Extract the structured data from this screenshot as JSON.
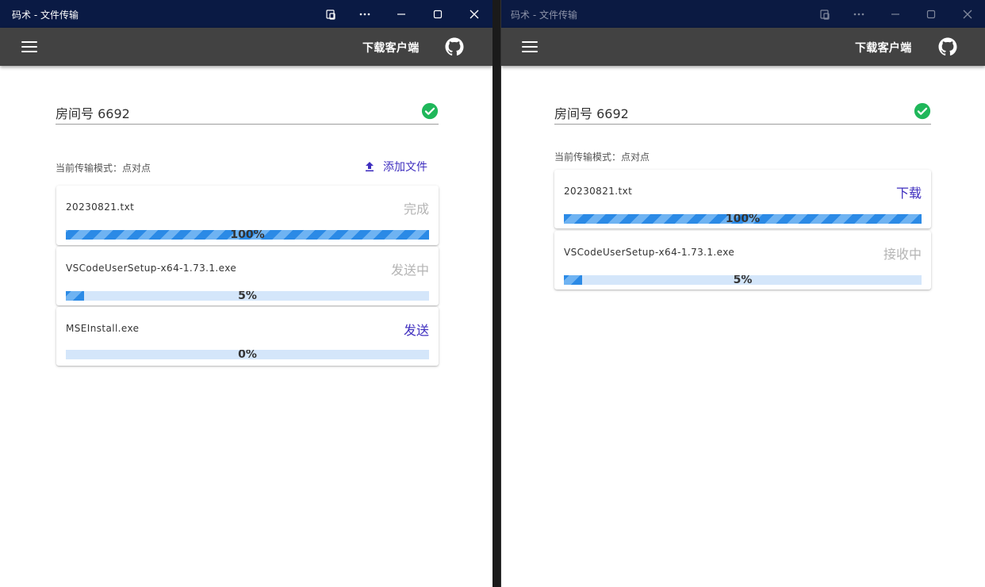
{
  "left_window": {
    "title": "码术 - 文件传输",
    "download_label": "下载客户端",
    "room_label": "房间号 6692",
    "mode_label": "当前传输模式：点对点",
    "add_file_label": "添加文件",
    "files": [
      {
        "name": "20230821.txt",
        "status": "完成",
        "progress": 100,
        "progress_label": "100%"
      },
      {
        "name": "VSCodeUserSetup-x64-1.73.1.exe",
        "status": "发送中",
        "progress": 5,
        "progress_label": "5%"
      },
      {
        "name": "MSEInstall.exe",
        "status": "发送",
        "progress": 0,
        "progress_label": "0%"
      }
    ]
  },
  "right_window": {
    "title": "码术 - 文件传输",
    "download_label": "下载客户端",
    "room_label": "房间号 6692",
    "mode_label": "当前传输模式：点对点",
    "files": [
      {
        "name": "20230821.txt",
        "status": "下载",
        "progress": 100,
        "progress_label": "100%"
      },
      {
        "name": "VSCodeUserSetup-x64-1.73.1.exe",
        "status": "接收中",
        "progress": 5,
        "progress_label": "5%"
      }
    ]
  },
  "colors": {
    "accent": "#3f2fbf",
    "appbar": "#424242",
    "titlebar": "#0a1a44",
    "success": "#1fb75a",
    "progress_fill": "#2b8ae6",
    "progress_track": "#d4e6fa"
  },
  "icons": {
    "menu": "hamburger-menu-icon",
    "github": "github-icon",
    "check": "check-circle-icon",
    "upload": "upload-icon",
    "titlebar": [
      "snap-layout-icon",
      "more-icon",
      "minimize-icon",
      "maximize-icon",
      "close-icon"
    ]
  }
}
